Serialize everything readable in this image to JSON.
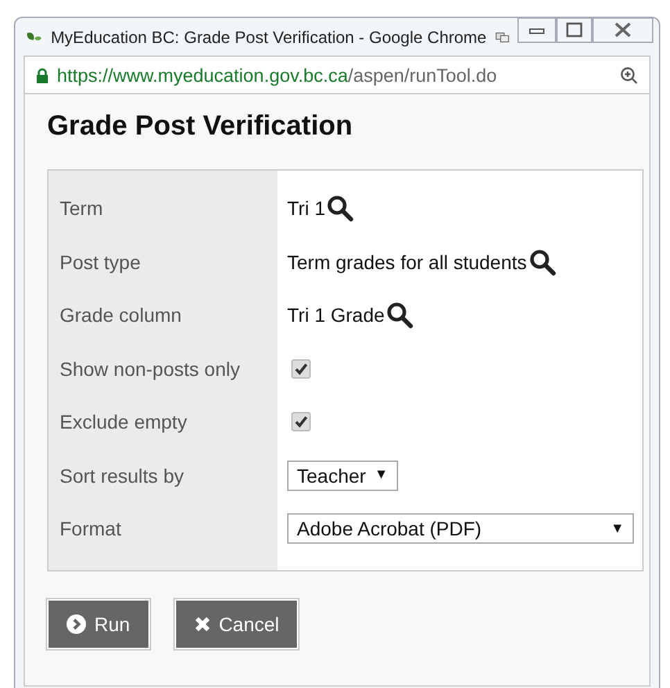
{
  "window": {
    "title": "MyEducation BC: Grade Post Verification - Google Chrome",
    "url_host": "https://www.myeducation.gov.bc.ca",
    "url_path": "/aspen/runTool.do"
  },
  "dialog": {
    "title": "Grade Post Verification"
  },
  "fields": [
    {
      "label": "Term",
      "kind": "lookup",
      "value": "Tri 1"
    },
    {
      "label": "Post type",
      "kind": "lookup",
      "value": "Term grades for all students"
    },
    {
      "label": "Grade column",
      "kind": "lookup",
      "value": "Tri 1 Grade"
    },
    {
      "label": "Show non-posts only",
      "kind": "checkbox",
      "checked": true
    },
    {
      "label": "Exclude empty",
      "kind": "checkbox",
      "checked": true
    },
    {
      "label": "Sort results by",
      "kind": "dropdown",
      "value": "Teacher",
      "arrow": "▼"
    },
    {
      "label": "Format",
      "kind": "wide-dropdown",
      "value": "Adobe Acrobat (PDF)",
      "arrow": "▼"
    }
  ],
  "buttons": [
    {
      "label": "Run",
      "kind": "run"
    },
    {
      "label": "Cancel",
      "kind": "cancel"
    }
  ]
}
